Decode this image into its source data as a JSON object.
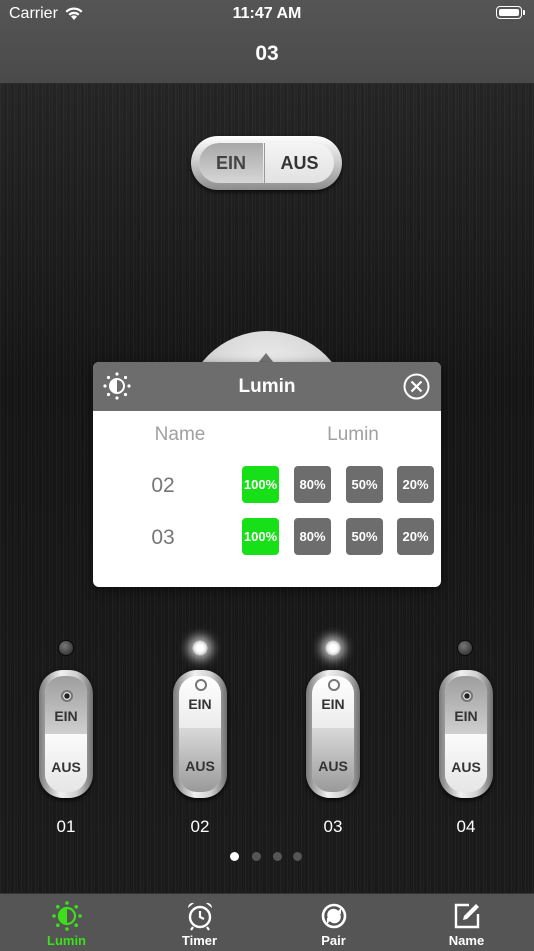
{
  "status_bar": {
    "carrier": "Carrier",
    "time": "11:47 AM"
  },
  "nav": {
    "title": "03"
  },
  "master_switch": {
    "on_label": "EIN",
    "off_label": "AUS"
  },
  "popup": {
    "title": "Lumin",
    "column_name": "Name",
    "column_lumin": "Lumin",
    "rows": [
      {
        "name": "02",
        "options": [
          "100%",
          "80%",
          "50%",
          "20%"
        ],
        "selected": "100%"
      },
      {
        "name": "03",
        "options": [
          "100%",
          "80%",
          "50%",
          "20%"
        ],
        "selected": "100%"
      }
    ]
  },
  "switches": [
    {
      "label": "01",
      "on_label": "EIN",
      "off_label": "AUS",
      "state": "off",
      "led": "dark"
    },
    {
      "label": "02",
      "on_label": "EIN",
      "off_label": "AUS",
      "state": "on",
      "led": "lit"
    },
    {
      "label": "03",
      "on_label": "EIN",
      "off_label": "AUS",
      "state": "on",
      "led": "lit"
    },
    {
      "label": "04",
      "on_label": "EIN",
      "off_label": "AUS",
      "state": "off",
      "led": "dark"
    }
  ],
  "page_indicator": {
    "count": 4,
    "active": 1
  },
  "tabbar": {
    "items": [
      {
        "label": "Lumin",
        "icon": "brightness-icon",
        "active": true
      },
      {
        "label": "Timer",
        "icon": "alarm-clock-icon",
        "active": false
      },
      {
        "label": "Pair",
        "icon": "sync-icon",
        "active": false
      },
      {
        "label": "Name",
        "icon": "edit-icon",
        "active": false
      }
    ]
  },
  "colors": {
    "selected_green": "#18e018",
    "active_tab": "#3ddf1a",
    "button_gray": "#6d6d6d"
  }
}
